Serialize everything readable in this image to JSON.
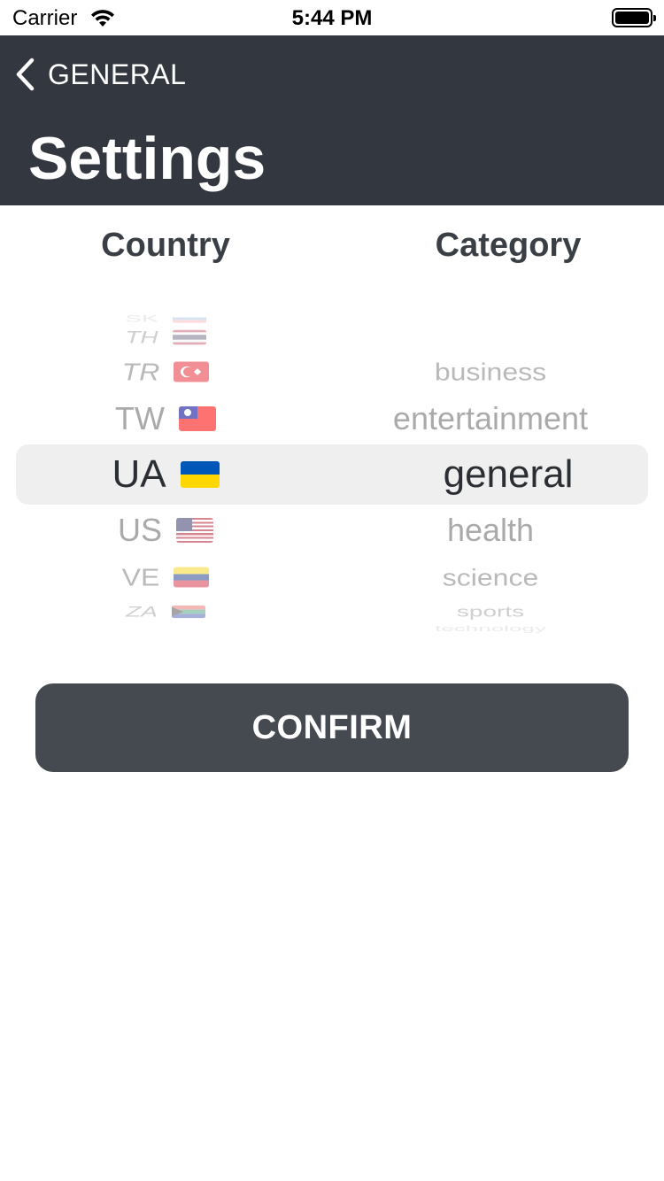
{
  "status_bar": {
    "carrier": "Carrier",
    "time": "5:44 PM",
    "wifi_icon": "wifi-icon",
    "battery_icon": "battery-icon"
  },
  "nav": {
    "back_label": "GENERAL",
    "back_icon": "chevron-left-icon",
    "title": "Settings",
    "background": "#333840"
  },
  "columns": {
    "country": "Country",
    "category": "Category"
  },
  "country_picker": {
    "selected": "UA",
    "items": [
      {
        "code": "SK",
        "flag": "flag-sk-icon"
      },
      {
        "code": "TH",
        "flag": "flag-th-icon"
      },
      {
        "code": "TR",
        "flag": "flag-tr-icon"
      },
      {
        "code": "TW",
        "flag": "flag-tw-icon"
      },
      {
        "code": "UA",
        "flag": "flag-ua-icon"
      },
      {
        "code": "US",
        "flag": "flag-us-icon"
      },
      {
        "code": "VE",
        "flag": "flag-ve-icon"
      },
      {
        "code": "ZA",
        "flag": "flag-za-icon"
      }
    ]
  },
  "category_picker": {
    "selected": "general",
    "items": [
      "business",
      "entertainment",
      "general",
      "health",
      "science",
      "sports",
      "technology"
    ]
  },
  "confirm": {
    "label": "CONFIRM",
    "background": "#454a51"
  }
}
